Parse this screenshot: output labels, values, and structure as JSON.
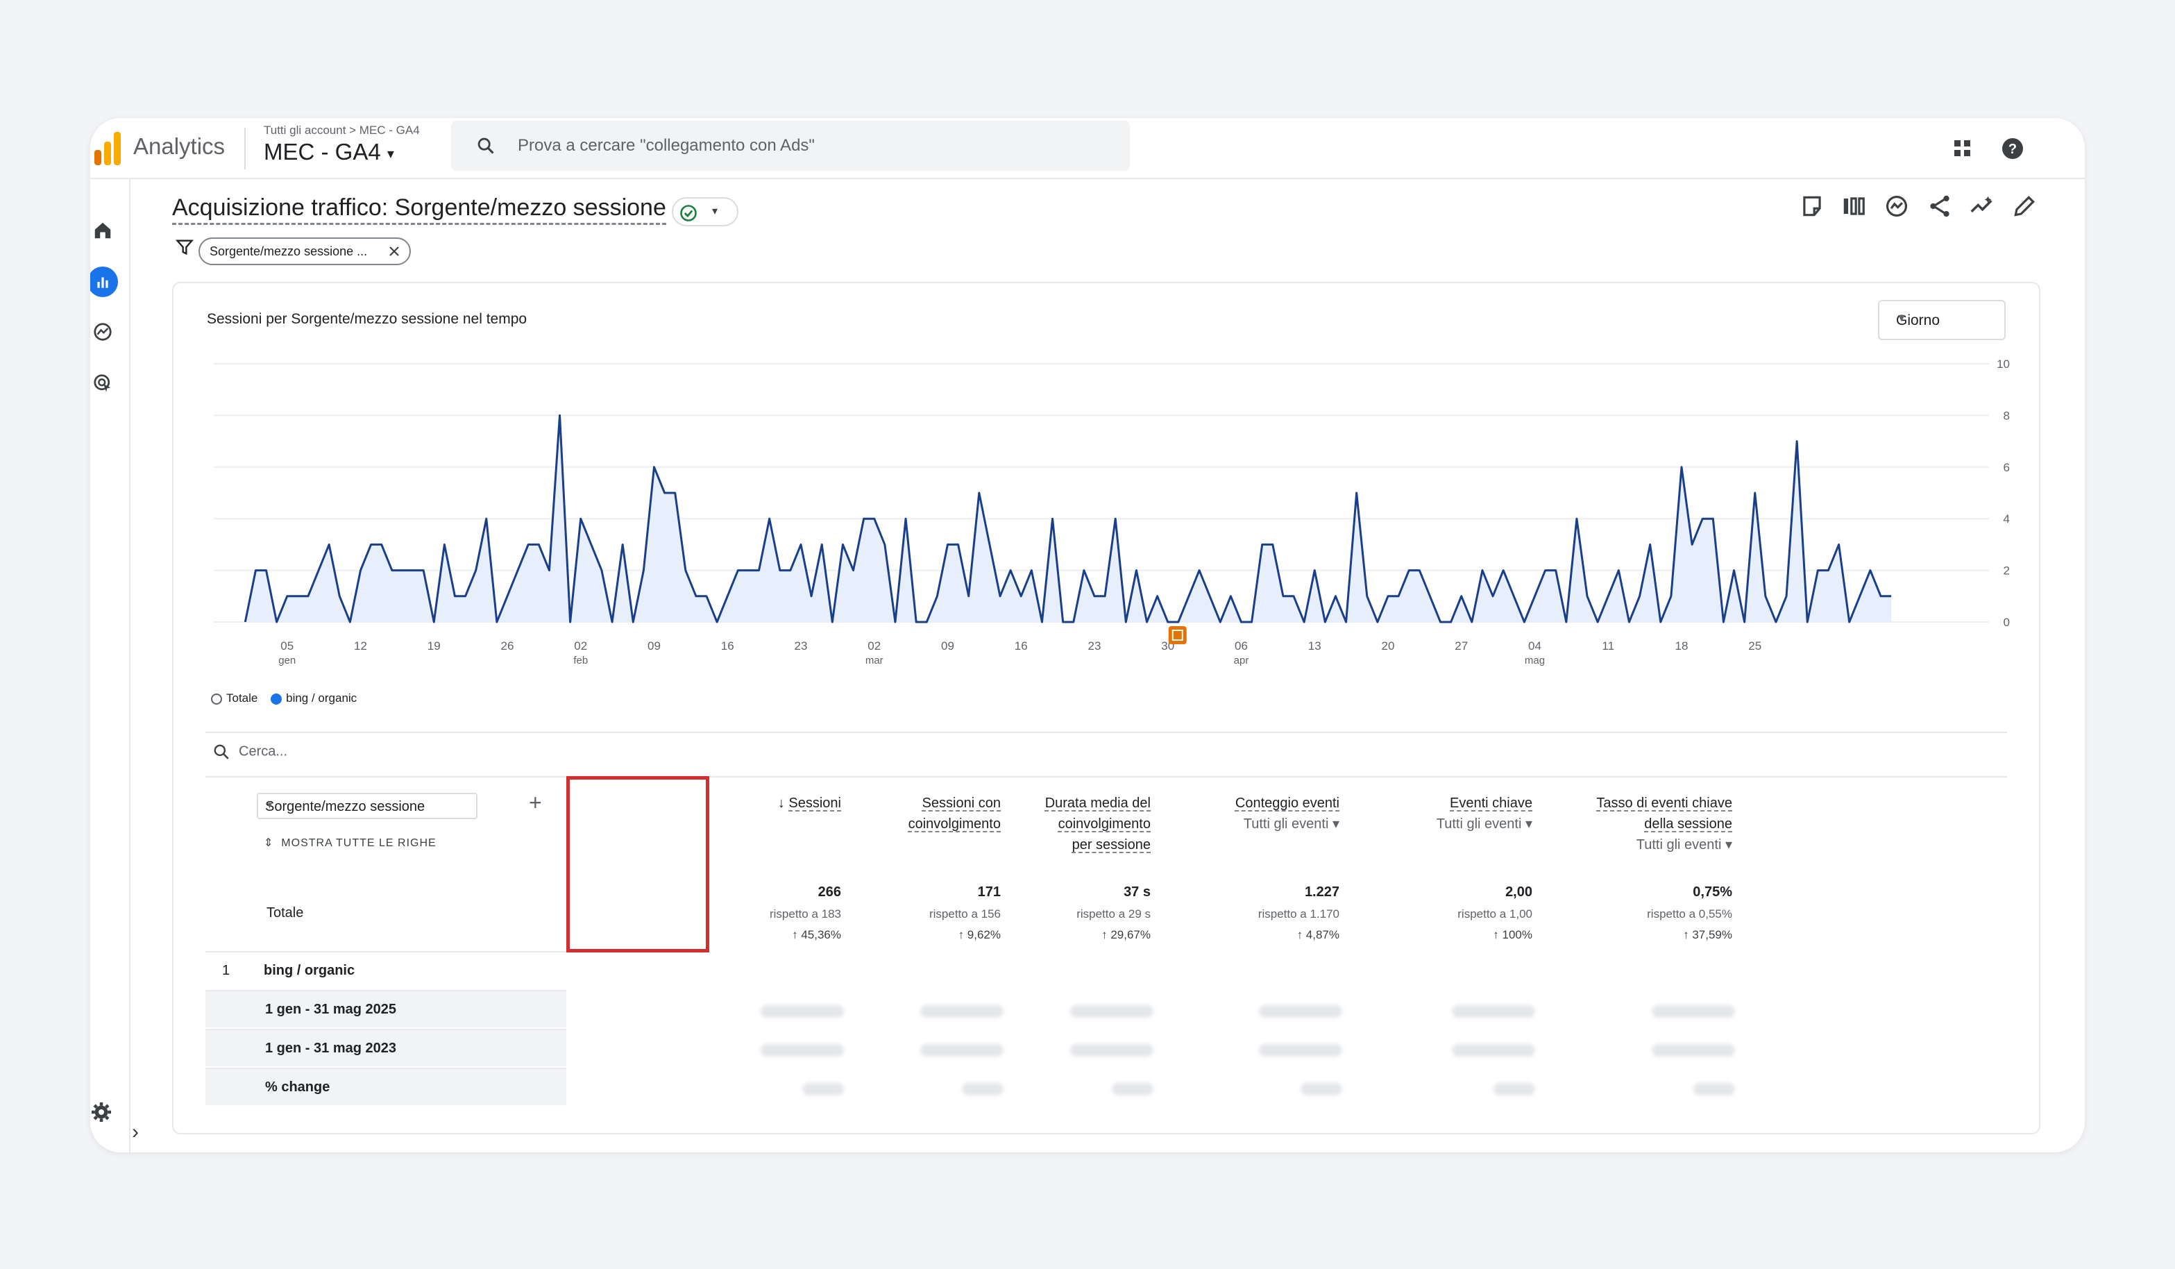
{
  "app": {
    "brand": "Analytics",
    "breadcrumb": "Tutti gli account > MEC - GA4",
    "property": "MEC - GA4",
    "search_placeholder": "Prova a cercare \"collegamento con Ads\""
  },
  "report": {
    "title": "Acquisizione traffico: Sorgente/mezzo sessione",
    "filter_chip": "Sorgente/mezzo sessione ..."
  },
  "chart": {
    "title": "Sessioni per Sorgente/mezzo sessione nel tempo",
    "granularity": "Giorno",
    "legend": [
      "Totale",
      "bing / organic"
    ]
  },
  "chart_data": {
    "type": "line",
    "title": "Sessioni per Sorgente/mezzo sessione nel tempo",
    "xlabel": "",
    "ylabel": "",
    "ylim": [
      0,
      10
    ],
    "y_ticks": [
      0,
      2,
      4,
      6,
      8,
      10
    ],
    "x_ticks": [
      {
        "label": "05",
        "sub": "gen"
      },
      {
        "label": "12",
        "sub": ""
      },
      {
        "label": "19",
        "sub": ""
      },
      {
        "label": "26",
        "sub": ""
      },
      {
        "label": "02",
        "sub": "feb"
      },
      {
        "label": "09",
        "sub": ""
      },
      {
        "label": "16",
        "sub": ""
      },
      {
        "label": "23",
        "sub": ""
      },
      {
        "label": "02",
        "sub": "mar"
      },
      {
        "label": "09",
        "sub": ""
      },
      {
        "label": "16",
        "sub": ""
      },
      {
        "label": "23",
        "sub": ""
      },
      {
        "label": "30",
        "sub": ""
      },
      {
        "label": "06",
        "sub": "apr"
      },
      {
        "label": "13",
        "sub": ""
      },
      {
        "label": "20",
        "sub": ""
      },
      {
        "label": "27",
        "sub": ""
      },
      {
        "label": "04",
        "sub": "mag"
      },
      {
        "label": "11",
        "sub": ""
      },
      {
        "label": "18",
        "sub": ""
      },
      {
        "label": "25",
        "sub": ""
      }
    ],
    "x_start": "2025-01-01",
    "series": [
      {
        "name": "bing / organic",
        "color": "#1a3f8a",
        "values": [
          0,
          2,
          2,
          0,
          1,
          1,
          1,
          2,
          3,
          1,
          0,
          2,
          3,
          3,
          2,
          2,
          2,
          2,
          0,
          3,
          1,
          1,
          2,
          4,
          0,
          1,
          2,
          3,
          3,
          2,
          8,
          0,
          4,
          3,
          2,
          0,
          3,
          0,
          2,
          6,
          5,
          5,
          2,
          1,
          1,
          0,
          1,
          2,
          2,
          2,
          4,
          2,
          2,
          3,
          1,
          3,
          0,
          3,
          2,
          4,
          4,
          3,
          0,
          4,
          0,
          0,
          1,
          3,
          3,
          1,
          5,
          3,
          1,
          2,
          1,
          2,
          0,
          4,
          0,
          0,
          2,
          1,
          1,
          4,
          0,
          2,
          0,
          1,
          0,
          0,
          1,
          2,
          1,
          0,
          1,
          0,
          0,
          3,
          3,
          1,
          1,
          0,
          2,
          0,
          1,
          0,
          5,
          1,
          0,
          1,
          1,
          2,
          2,
          1,
          0,
          0,
          1,
          0,
          2,
          1,
          2,
          1,
          0,
          1,
          2,
          2,
          0,
          4,
          1,
          0,
          1,
          2,
          0,
          1,
          3,
          0,
          1,
          6,
          3,
          4,
          4,
          0,
          2,
          0,
          5,
          1,
          0,
          1,
          7,
          0,
          2,
          2,
          3,
          0,
          1,
          2,
          1,
          1
        ]
      }
    ]
  },
  "table": {
    "search_placeholder": "Cerca...",
    "dimension": "Sorgente/mezzo sessione",
    "show_all": "MOSTRA TUTTE LE RIGHE",
    "total_label": "Totale",
    "columns": [
      {
        "title1": "Sessioni",
        "title2": "",
        "title3": "",
        "sub": "",
        "total": "266",
        "compare": "rispetto a 183",
        "change": "↑ 45,36%"
      },
      {
        "title1": "Sessioni con",
        "title2": "coinvolgimento",
        "title3": "",
        "sub": "",
        "total": "171",
        "compare": "rispetto a 156",
        "change": "↑ 9,62%"
      },
      {
        "title1": "Durata media del",
        "title2": "coinvolgimento",
        "title3": "per sessione",
        "sub": "",
        "total": "37 s",
        "compare": "rispetto a 29 s",
        "change": "↑ 29,67%"
      },
      {
        "title1": "Conteggio eventi",
        "title2": "",
        "title3": "",
        "sub": "Tutti gli eventi ▾",
        "total": "1.227",
        "compare": "rispetto a 1.170",
        "change": "↑ 4,87%"
      },
      {
        "title1": "Eventi chiave",
        "title2": "",
        "title3": "",
        "sub": "Tutti gli eventi ▾",
        "total": "2,00",
        "compare": "rispetto a 1,00",
        "change": "↑ 100%"
      },
      {
        "title1": "Tasso di eventi chiave",
        "title2": "della sessione",
        "title3": "",
        "sub": "Tutti gli eventi ▾",
        "total": "0,75%",
        "compare": "rispetto a 0,55%",
        "change": "↑ 37,59%"
      }
    ],
    "rows": [
      {
        "index": "1",
        "label": "bing / organic"
      },
      {
        "index": "",
        "label": "1 gen - 31 mag 2025"
      },
      {
        "index": "",
        "label": "1 gen - 31 mag 2023"
      },
      {
        "index": "",
        "label": "% change"
      }
    ]
  },
  "colors": {
    "accent": "#1a73e8",
    "line": "#1a3f8a",
    "highlight": "#d32f2f"
  }
}
